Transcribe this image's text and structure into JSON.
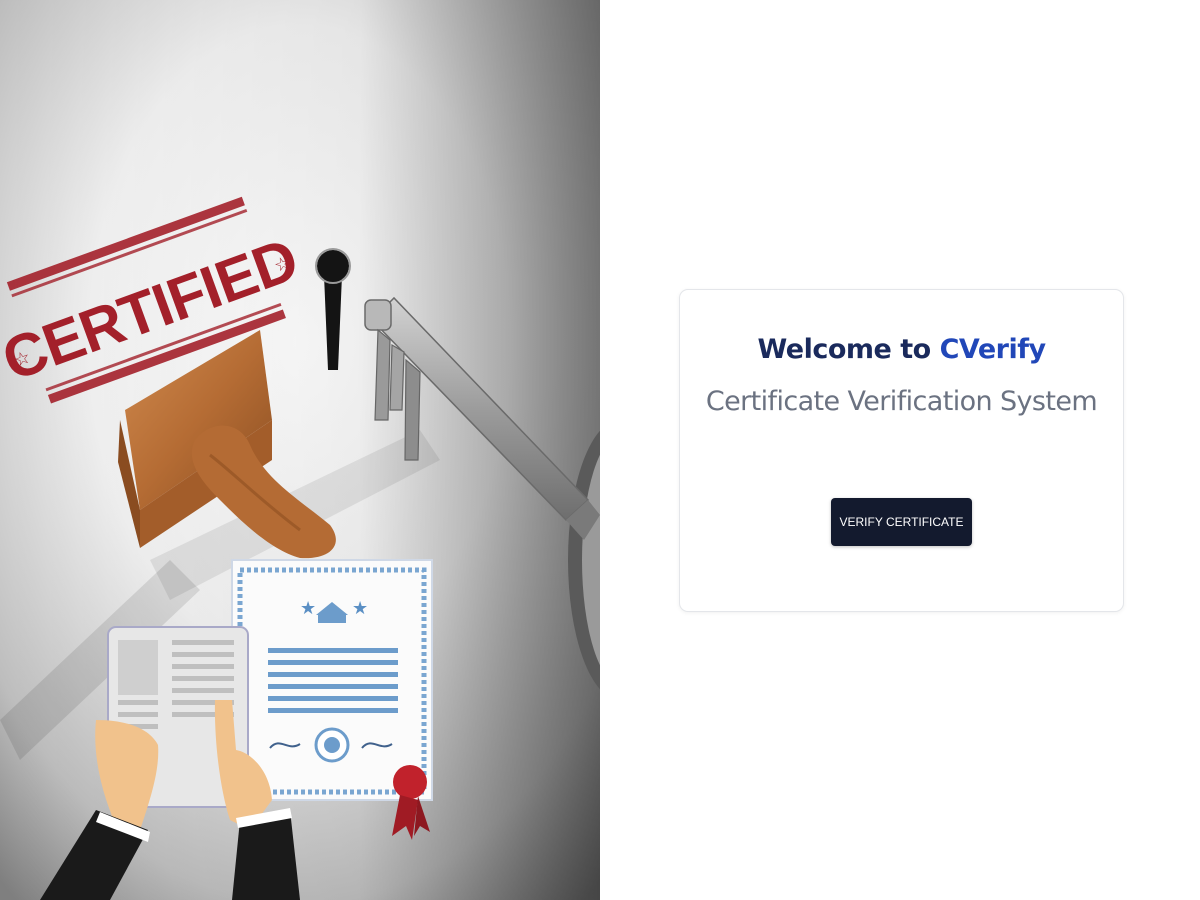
{
  "hero": {
    "stamp_text": "CERTIFIED"
  },
  "welcome": {
    "title_prefix": "Welcome to ",
    "title_brand": "CVerify",
    "subtitle": "Certificate Verification System"
  },
  "actions": {
    "verify_label": "VERIFY CERTIFICATE"
  },
  "colors": {
    "title_dark": "#1a2a5c",
    "brand_blue": "#2147b8",
    "subtitle_gray": "#6b7281",
    "button_bg": "#131a2e",
    "stamp_red": "#a3202a"
  }
}
